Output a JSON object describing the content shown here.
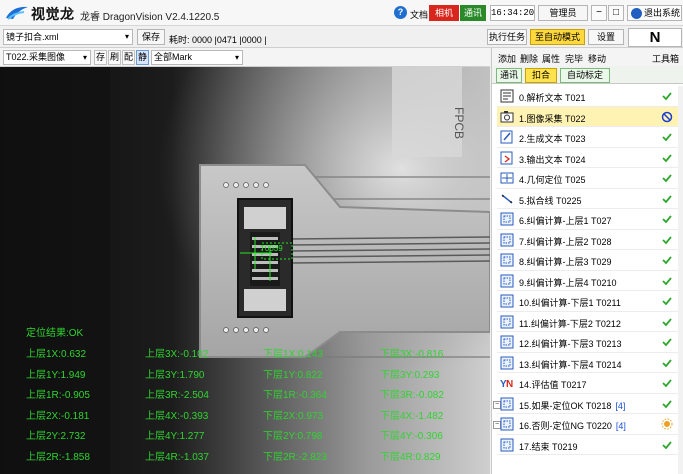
{
  "titlebar": {
    "brand": "视觉龙",
    "app_title": "龙睿 DragonVision V2.4.1220.5",
    "doc_label": "文档",
    "camera_status": "相机",
    "comm_status": "通讯",
    "clock": "16:34:20",
    "user": "管理员",
    "minimize": "−",
    "maximize": "□",
    "exit": "退出系统"
  },
  "toolbar": {
    "recipe": "镜子扣合.xml",
    "save": "保存",
    "elapsed": "耗时: 0000 |0471 |0000 |",
    "run_task": "执行任务",
    "auto_mode": "至自动模式",
    "settings": "设置",
    "indicator": "N"
  },
  "imagebar": {
    "task_select": "T022.采集图像",
    "btn_save": "存",
    "btn_refresh": "刷",
    "btn_config": "配",
    "btn_static": "静",
    "mark_select": "全部Mark"
  },
  "viewport": {
    "pcb_label": "FPCB",
    "target_label": "T0039",
    "result_title": "定位结果:OK",
    "results": [
      [
        "上层1X:0.632",
        "上层3X:-0.102",
        "下层1X:0.143",
        "下层3X:-0.816"
      ],
      [
        "上层1Y:1.949",
        "上层3Y:1.790",
        "下层1Y:0.822",
        "下层3Y:0.293"
      ],
      [
        "上层1R:-0.905",
        "上层3R:-2.504",
        "下层1R:-0.364",
        "下层3R:-0.082"
      ],
      [
        "上层2X:-0.181",
        "上层4X:-0.393",
        "下层2X:0.973",
        "下层4X:-1.482"
      ],
      [
        "上层2Y:2.732",
        "上层4Y:1.277",
        "下层2Y:0.798",
        "下层4Y:-0.306"
      ],
      [
        "上层2R:-1.858",
        "上层4R:-1.037",
        "下层2R:-2.823",
        "下层4R:0.829"
      ]
    ]
  },
  "panel": {
    "menu": {
      "add": "添加",
      "delete": "删除",
      "properties": "属性",
      "run_to": "完毕",
      "move": "移动",
      "toolbox": "工具箱"
    },
    "tabs": [
      "通讯",
      "扣合",
      "自动标定"
    ],
    "active_tab": "扣合",
    "tasks": [
      {
        "label": "0.解析文本 T021",
        "icon": "text-parse-icon",
        "status": "ok"
      },
      {
        "label": "1.图像采集 T022",
        "icon": "camera-capture-icon",
        "status": "blocked"
      },
      {
        "label": "2.生成文本 T023",
        "icon": "text-generate-icon",
        "status": "ok"
      },
      {
        "label": "3.输出文本 T024",
        "icon": "text-output-icon",
        "status": "ok"
      },
      {
        "label": "4.几何定位 T025",
        "icon": "geometry-locate-icon",
        "status": "ok"
      },
      {
        "label": "5.拟合线 T0225",
        "icon": "fit-line-icon",
        "status": "ok"
      },
      {
        "label": "6.纠偏计算-上层1 T027",
        "icon": "correction-icon",
        "status": "ok"
      },
      {
        "label": "7.纠偏计算-上层2 T028",
        "icon": "correction-icon",
        "status": "ok"
      },
      {
        "label": "8.纠偏计算-上层3 T029",
        "icon": "correction-icon",
        "status": "ok"
      },
      {
        "label": "9.纠偏计算-上层4 T0210",
        "icon": "correction-icon",
        "status": "ok"
      },
      {
        "label": "10.纠偏计算-下层1 T0211",
        "icon": "correction-icon",
        "status": "ok"
      },
      {
        "label": "11.纠偏计算-下层2 T0212",
        "icon": "correction-icon",
        "status": "ok"
      },
      {
        "label": "12.纠偏计算-下层3 T0213",
        "icon": "correction-icon",
        "status": "ok"
      },
      {
        "label": "13.纠偏计算-下层4 T0214",
        "icon": "correction-icon",
        "status": "ok"
      },
      {
        "label": "14.评估值 T0217",
        "icon": "evaluate-icon",
        "status": "ok"
      },
      {
        "label": "15.如果-定位OK T0218",
        "tag": "[4]",
        "icon": "condition-icon",
        "status": "ok"
      },
      {
        "label": "16.否则-定位NG T0220",
        "tag": "[4]",
        "icon": "condition-icon",
        "status": "pending"
      },
      {
        "label": "17.结束 T0219",
        "icon": "end-icon",
        "status": "ok"
      }
    ]
  },
  "colors": {
    "ok": "#2fa82f",
    "result_text": "#2fd42f",
    "camera": "#d9261c",
    "comm": "#2a8a2a",
    "auto_mode": "#ffd83d",
    "selected_row": "#fff3b3"
  }
}
